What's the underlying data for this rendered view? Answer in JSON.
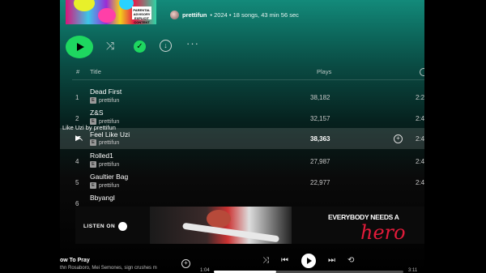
{
  "header": {
    "artist": "prettifun",
    "details": "• 2024 • 18 songs, 43 min 56 sec",
    "cover_badge": "PARENTAL ADVISORY EXPLICIT CONTENT"
  },
  "columns": {
    "num": "#",
    "title": "Title",
    "plays": "Plays"
  },
  "tracks": [
    {
      "num": "1",
      "title": "Dead First",
      "artist": "prettifun",
      "plays": "38,182",
      "duration": "2:2"
    },
    {
      "num": "2",
      "title": "Z&S",
      "artist": "prettifun",
      "plays": "32,157",
      "duration": "2:4"
    },
    {
      "num": "",
      "title": "Feel Like Uzi",
      "artist": "prettifun",
      "plays": "38,363",
      "duration": "2:4"
    },
    {
      "num": "4",
      "title": "Rolled1",
      "artist": "prettifun",
      "plays": "27,987",
      "duration": "2:4"
    },
    {
      "num": "5",
      "title": "Gaultier Bag",
      "artist": "prettifun",
      "plays": "22,977",
      "duration": "2:4"
    },
    {
      "num": "6",
      "title": "Bbyangl",
      "artist": "",
      "plays": "",
      "duration": ""
    }
  ],
  "explicit_badge": "E",
  "drag_label": "Like Uzi by prettifun",
  "ad": {
    "listen_on": "LISTEN ON",
    "headline": "EVERYBODY NEEDS A",
    "hero": "hero"
  },
  "now_playing": {
    "title": "ow To Pray",
    "subtitle": "thn Rosaboro, Mei Semones, sign crushes m",
    "time_current": "1:04",
    "time_total": "3:11",
    "progress": 0.33
  },
  "colors": {
    "accent": "#1ed760",
    "hero_red": "#e21b3a"
  }
}
